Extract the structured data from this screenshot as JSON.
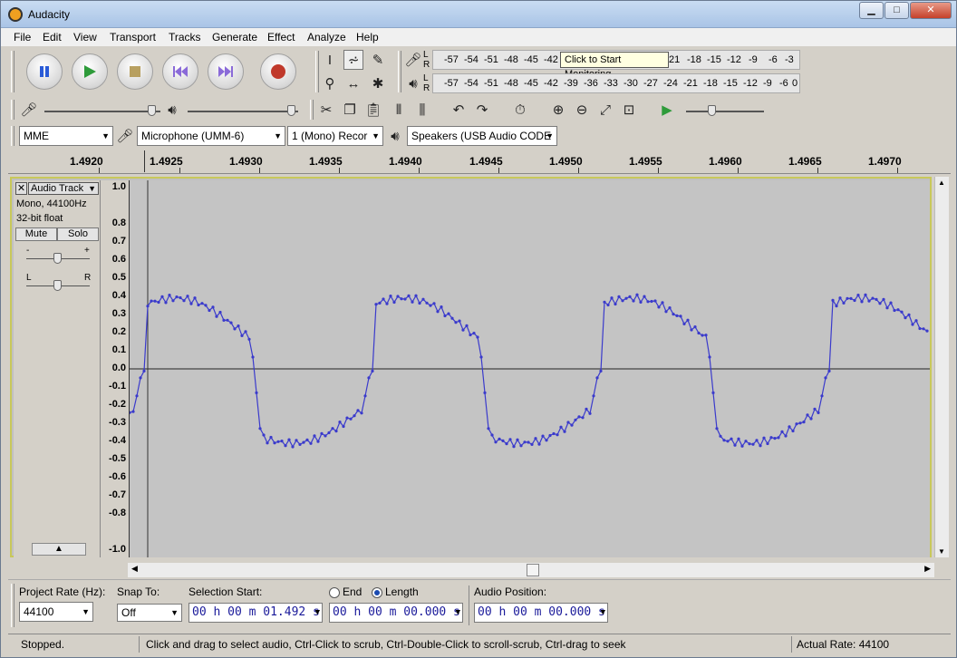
{
  "window": {
    "title": "Audacity"
  },
  "menu": [
    "File",
    "Edit",
    "View",
    "Transport",
    "Tracks",
    "Generate",
    "Effect",
    "Analyze",
    "Help"
  ],
  "meters": {
    "record_ticks": [
      "-57",
      "-54",
      "-51",
      "-48",
      "-45",
      "-42",
      "-3",
      "21",
      "-18",
      "-15",
      "-12",
      "-9",
      "-6",
      "-3",
      "0"
    ],
    "record_tooltip": "Click to Start Monitoring",
    "play_ticks": [
      "-57",
      "-54",
      "-51",
      "-48",
      "-45",
      "-42",
      "-39",
      "-36",
      "-33",
      "-30",
      "-27",
      "-24",
      "-21",
      "-18",
      "-15",
      "-12",
      "-9",
      "-6",
      "-3",
      "0"
    ],
    "lr": [
      "L",
      "R"
    ]
  },
  "device": {
    "host": "MME",
    "input": "Microphone (UMM-6)",
    "channels": "1 (Mono) Recor",
    "output": "Speakers (USB Audio CODE"
  },
  "ruler": [
    "1.4920",
    "1.4925",
    "1.4930",
    "1.4935",
    "1.4940",
    "1.4945",
    "1.4950",
    "1.4955",
    "1.4960",
    "1.4965",
    "1.4970"
  ],
  "track": {
    "name": "Audio Track",
    "info1": "Mono, 44100Hz",
    "info2": "32-bit float",
    "mute": "Mute",
    "solo": "Solo",
    "gain_minus": "-",
    "gain_plus": "+",
    "pan_l": "L",
    "pan_r": "R"
  },
  "vruler": [
    "1.0",
    "0.8",
    "0.7",
    "0.6",
    "0.5",
    "0.4",
    "0.3",
    "0.2",
    "0.1",
    "0.0",
    "-0.1",
    "-0.2",
    "-0.3",
    "-0.4",
    "-0.5",
    "-0.6",
    "-0.7",
    "-0.8",
    "-1.0"
  ],
  "selection": {
    "rate_label": "Project Rate (Hz):",
    "rate_value": "44100",
    "snap_label": "Snap To:",
    "snap_value": "Off",
    "start_label": "Selection Start:",
    "start_value": "00 h 00 m 01.492 s",
    "end_label": "End",
    "length_label": "Length",
    "length_value": "00 h 00 m 00.000 s",
    "pos_label": "Audio Position:",
    "pos_value": "00 h 00 m 00.000 s"
  },
  "status": {
    "left": "Stopped.",
    "hint": "Click and drag to select audio, Ctrl-Click to scrub, Ctrl-Double-Click to scroll-scrub, Ctrl-drag to seek",
    "rate": "Actual Rate: 44100"
  },
  "colors": {
    "wave": "#3a3acc",
    "track_border": "#c8c85a",
    "record": "#c0392b",
    "play": "#2e9b3a",
    "pause": "#2a5bd7"
  }
}
